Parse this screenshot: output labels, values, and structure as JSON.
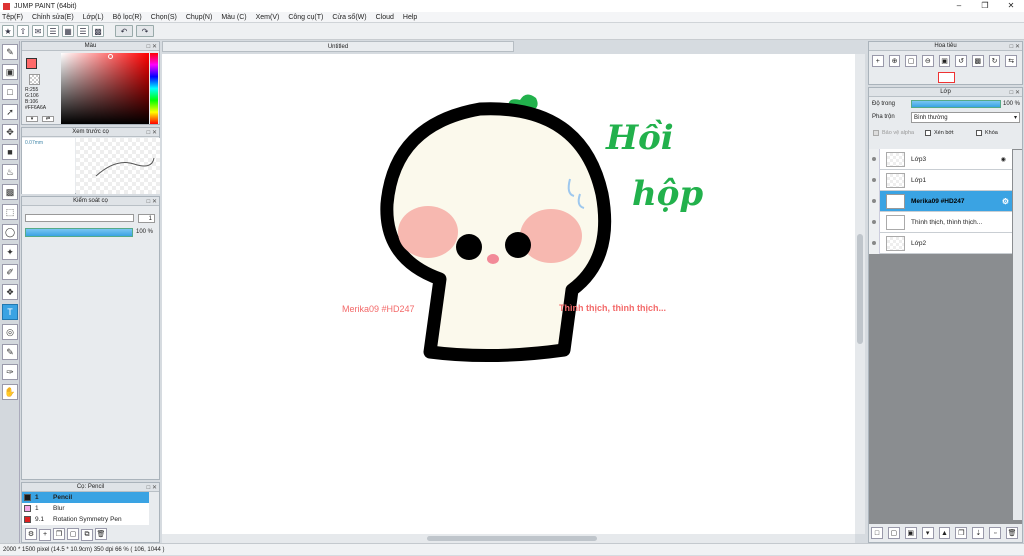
{
  "window": {
    "title": "JUMP PAINT (64bit)"
  },
  "menu": [
    "Tệp(F)",
    "Chỉnh sửa(E)",
    "Lớp(L)",
    "Bộ lọc(R)",
    "Chọn(S)",
    "Chụp(N)",
    "Màu (C)",
    "Xem(V)",
    "Công cụ(T)",
    "Cửa sổ(W)",
    "Cloud",
    "Help"
  ],
  "color_panel": {
    "title": "Màu",
    "r": "R:255",
    "g": "G:106",
    "b": "B:106",
    "hex": "#FF6A6A",
    "accent": "#ff6a6a"
  },
  "brush_preview": {
    "title": "Xem trước cọ",
    "size": "0.07mm"
  },
  "brush_control": {
    "title": "Kiểm soát cọ",
    "size_value": "1",
    "opacity_value": "100 %"
  },
  "brushes": {
    "title": "Cọ: Pencil",
    "items": [
      {
        "size": "1",
        "name": "Pencil",
        "color": "#000000"
      },
      {
        "size": "1",
        "name": "Blur",
        "color": "#f3a6e6"
      },
      {
        "size": "9.1",
        "name": "Rotation Symmetry Pen",
        "color": "#e02020"
      }
    ]
  },
  "document": {
    "tab": "Untitled"
  },
  "canvas": {
    "text_left": "Merika09 #HD247",
    "text_right": "Thình thịch, thình thịch...",
    "hand1": "Hồi",
    "hand2": "hộp"
  },
  "navigator": {
    "title": "Hoa tiêu"
  },
  "layers": {
    "title": "Lớp",
    "opacity_label": "Độ trong",
    "opacity_value": "100 %",
    "blend_label": "Pha trộn",
    "blend_value": "Bình thường",
    "protect_alpha": "Bảo vệ alpha",
    "clip": "Xén bớt",
    "lock": "Khóa",
    "items": [
      {
        "name": "Lớp3"
      },
      {
        "name": "Lớp1"
      },
      {
        "name": "Merika09 #HD247"
      },
      {
        "name": "Thình thịch, thình thịch..."
      },
      {
        "name": "Lớp2"
      }
    ]
  },
  "status": {
    "text": "2000 * 1500 pixel   (14.5 * 10.9cm)   350 dpi   66 %   ( 106, 1044 )"
  }
}
